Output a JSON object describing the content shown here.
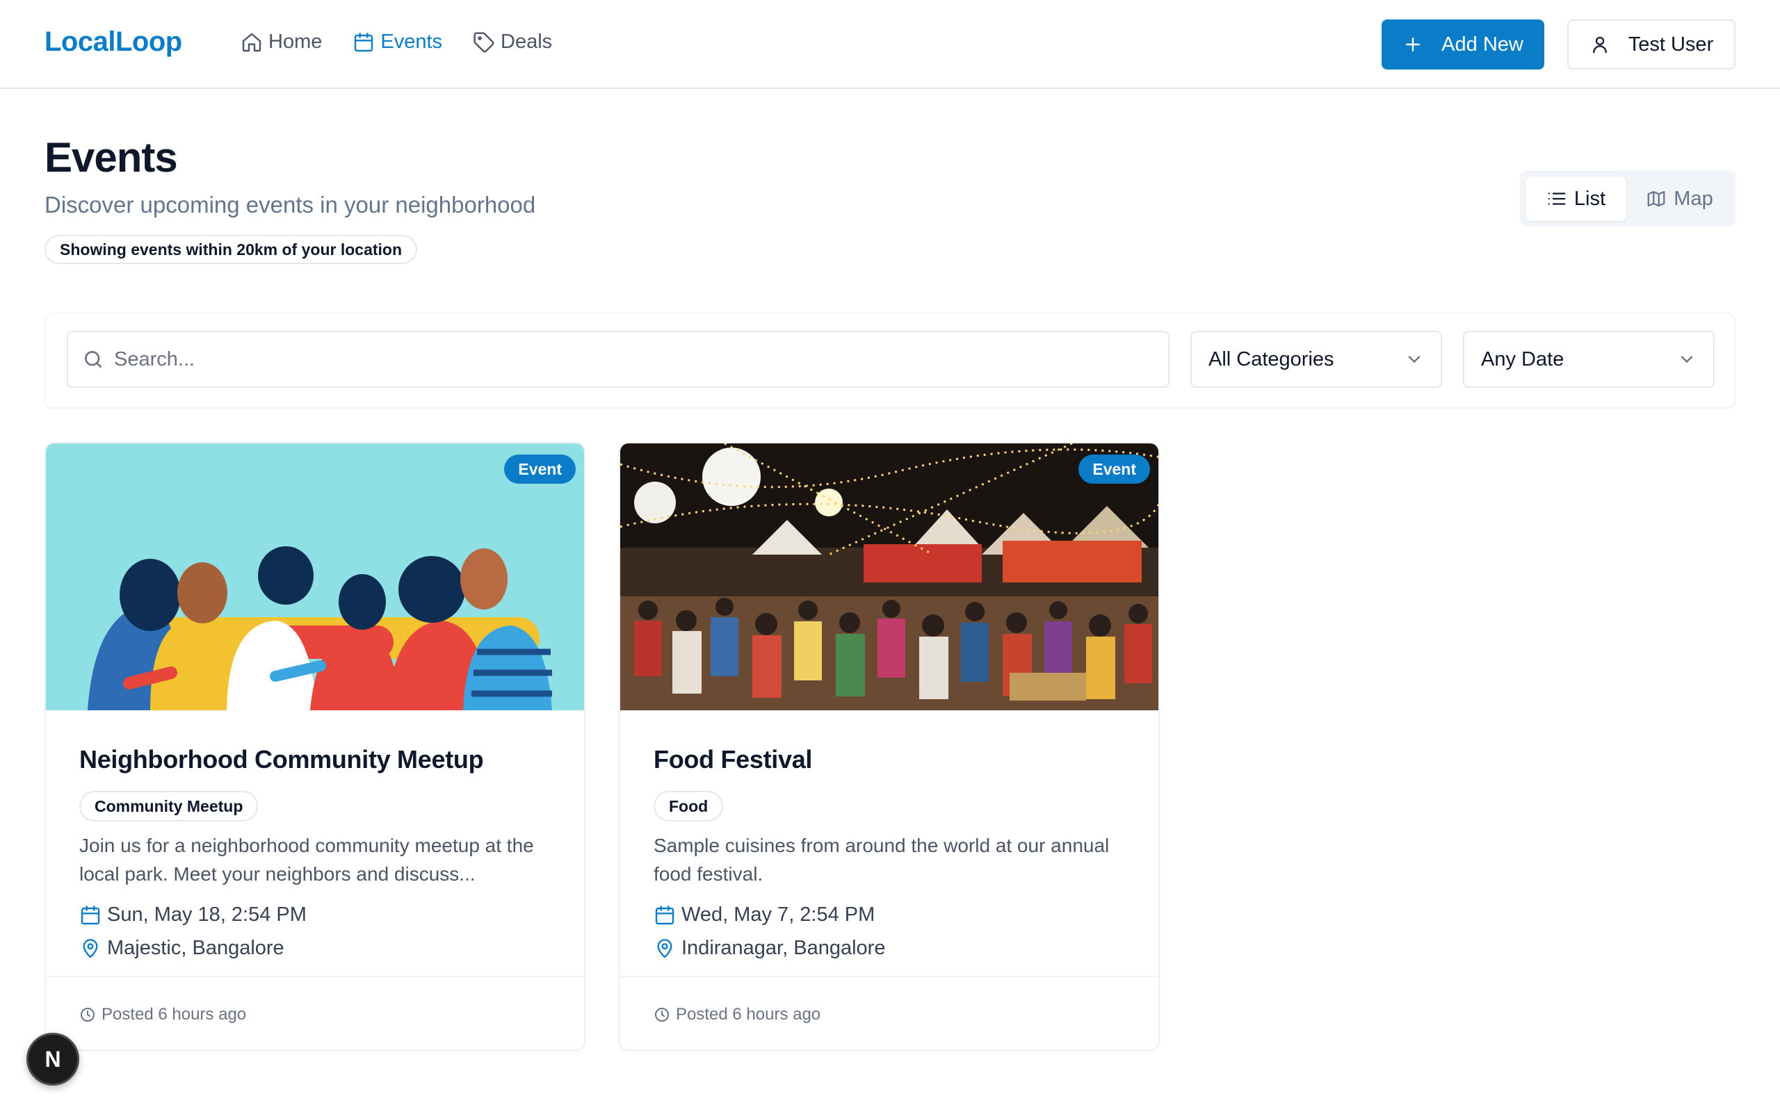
{
  "header": {
    "logo": "LocalLoop",
    "nav": [
      {
        "label": "Home",
        "icon": "home-icon"
      },
      {
        "label": "Events",
        "icon": "calendar-icon",
        "active": true
      },
      {
        "label": "Deals",
        "icon": "tag-icon"
      }
    ],
    "add_new_label": "Add New",
    "user_label": "Test User"
  },
  "page": {
    "title": "Events",
    "subtitle": "Discover upcoming events in your neighborhood",
    "location_note": "Showing events within 20km of your location"
  },
  "view_toggle": {
    "list_label": "List",
    "map_label": "Map",
    "selected": "List"
  },
  "filters": {
    "search_placeholder": "Search...",
    "search_value": "",
    "category_value": "All Categories",
    "date_value": "Any Date"
  },
  "events": [
    {
      "badge": "Event",
      "title": "Neighborhood Community Meetup",
      "category": "Community Meetup",
      "description": "Join us for a neighborhood community meetup at the local park. Meet your neighbors and discuss...",
      "date": "Sun, May 18, 2:54 PM",
      "location": "Majestic, Bangalore",
      "posted": "Posted 6 hours ago"
    },
    {
      "badge": "Event",
      "title": "Food Festival",
      "category": "Food",
      "description": "Sample cuisines from around the world at our annual food festival.",
      "date": "Wed, May 7, 2:54 PM",
      "location": "Indiranagar, Bangalore",
      "posted": "Posted 6 hours ago"
    }
  ],
  "colors": {
    "brand": "#0b7dc8",
    "text": "#0f172a",
    "muted": "#64748b",
    "border": "#e5e7eb"
  }
}
